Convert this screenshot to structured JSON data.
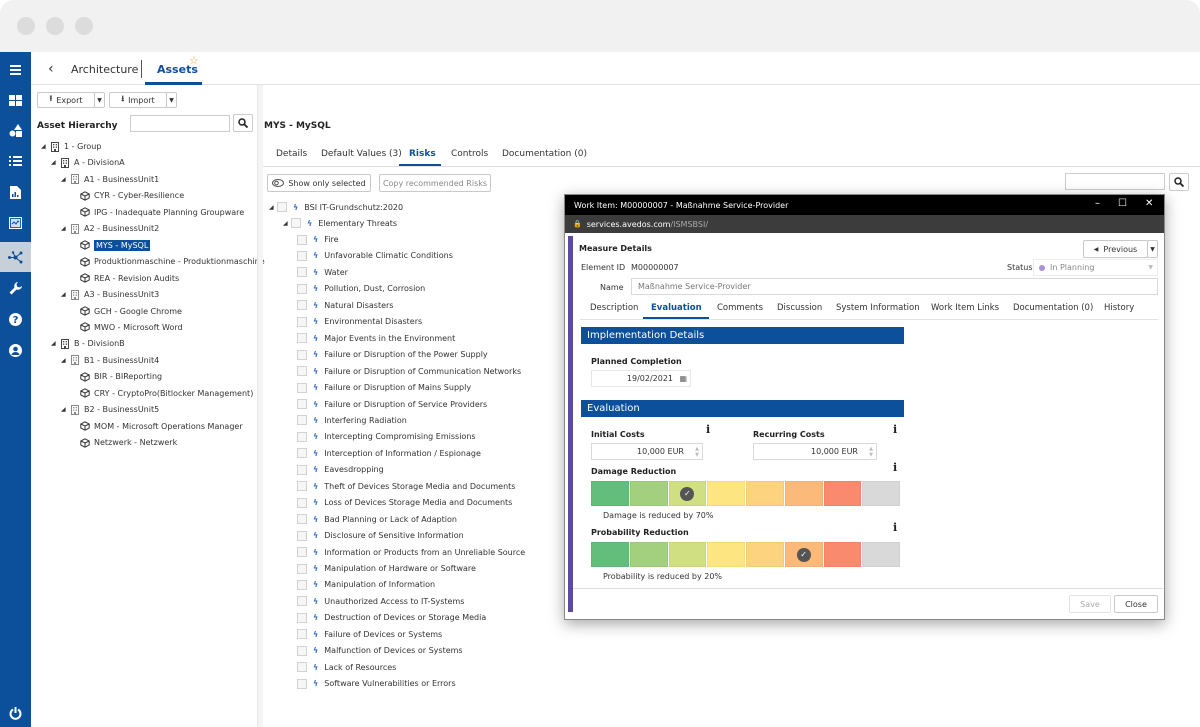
{
  "header": {
    "back_label": "Architecture",
    "active_crumb": "Assets"
  },
  "toolbar": {
    "export_label": "Export",
    "import_label": "Import"
  },
  "hierarchy": {
    "title": "Asset Hierarchy",
    "search_placeholder": "",
    "items": [
      {
        "label": "1 - Group",
        "level": 0,
        "type": "group",
        "expanded": true
      },
      {
        "label": "A - DivisionA",
        "level": 1,
        "type": "group",
        "expanded": true
      },
      {
        "label": "A1 - BusinessUnit1",
        "level": 2,
        "type": "unit",
        "expanded": true
      },
      {
        "label": "CYR - Cyber-Resilience",
        "level": 3,
        "type": "asset"
      },
      {
        "label": "IPG - Inadequate Planning Groupware",
        "level": 3,
        "type": "asset"
      },
      {
        "label": "A2 - BusinessUnit2",
        "level": 2,
        "type": "unit",
        "expanded": true
      },
      {
        "label": "MYS - MySQL",
        "level": 3,
        "type": "asset",
        "selected": true
      },
      {
        "label": "Produktionmaschine - Produktionmaschine",
        "level": 3,
        "type": "asset"
      },
      {
        "label": "REA - Revision Audits",
        "level": 3,
        "type": "asset"
      },
      {
        "label": "A3 - BusinessUnit3",
        "level": 2,
        "type": "unit",
        "expanded": true
      },
      {
        "label": "GCH - Google Chrome",
        "level": 3,
        "type": "asset"
      },
      {
        "label": "MWO - Microsoft Word",
        "level": 3,
        "type": "asset"
      },
      {
        "label": "B - DivisionB",
        "level": 1,
        "type": "group",
        "expanded": true
      },
      {
        "label": "B1 - BusinessUnit4",
        "level": 2,
        "type": "unit",
        "expanded": true
      },
      {
        "label": "BIR - BIReporting",
        "level": 3,
        "type": "asset"
      },
      {
        "label": "CRY - CryptoPro(Bitlocker Management)",
        "level": 3,
        "type": "asset"
      },
      {
        "label": "B2 - BusinessUnit5",
        "level": 2,
        "type": "unit",
        "expanded": true
      },
      {
        "label": "MOM - Microsoft Operations Manager",
        "level": 3,
        "type": "asset"
      },
      {
        "label": "Netzwerk - Netzwerk",
        "level": 3,
        "type": "asset"
      }
    ]
  },
  "asset": {
    "title": "MYS - MySQL",
    "tabs": [
      {
        "label": "Details",
        "active": false
      },
      {
        "label": "Default Values (3)",
        "active": false
      },
      {
        "label": "Risks",
        "active": true
      },
      {
        "label": "Controls",
        "active": false
      },
      {
        "label": "Documentation (0)",
        "active": false
      }
    ],
    "show_only_selected_label": "Show only selected",
    "copy_recommended_label": "Copy recommended Risks",
    "risk_root": "BSI IT-Grundschutz:2020",
    "risk_group": "Elementary Threats",
    "risks": [
      "Fire",
      "Unfavorable Climatic Conditions",
      "Water",
      "Pollution, Dust, Corrosion",
      "Natural Disasters",
      "Environmental Disasters",
      "Major Events in the Environment",
      "Failure or Disruption of the Power Supply",
      "Failure or Disruption of Communication Networks",
      "Failure or Disruption of Mains Supply",
      "Failure or Disruption of Service Providers",
      "Interfering Radiation",
      "Intercepting Compromising Emissions",
      "Interception of Information / Espionage",
      "Eavesdropping",
      "Theft of Devices Storage Media and Documents",
      "Loss of Devices Storage Media and Documents",
      "Bad Planning or Lack of Adaption",
      "Disclosure of Sensitive Information",
      "Information or Products from an Unreliable Source",
      "Manipulation of Hardware or Software",
      "Manipulation of Information",
      "Unauthorized Access to IT-Systems",
      "Destruction of Devices or Storage Media",
      "Failure of Devices or Systems",
      "Malfunction of Devices or Systems",
      "Lack of Resources",
      "Software Vulnerabilities or Errors"
    ]
  },
  "modal": {
    "window_title": "Work Item: M00000007 - Maßnahme Service-Provider",
    "url_host": "services.avedos.com",
    "url_path": "/ISMSBSI/",
    "heading": "Measure Details",
    "previous_label": "Previous",
    "element_id_label": "Element ID",
    "element_id": "M00000007",
    "status_label": "Status",
    "status_value": "In Planning",
    "status_color": "#a98fd6",
    "name_label": "Name",
    "name_value": "Maßnahme Service-Provider",
    "tabs": [
      {
        "label": "Description",
        "active": false
      },
      {
        "label": "Evaluation",
        "active": true
      },
      {
        "label": "Comments",
        "active": false
      },
      {
        "label": "Discussion",
        "active": false
      },
      {
        "label": "System Information",
        "active": false
      },
      {
        "label": "Work Item Links",
        "active": false
      },
      {
        "label": "Documentation (0)",
        "active": false
      },
      {
        "label": "History",
        "active": false
      }
    ],
    "implementation_header": "Implementation Details",
    "planned_completion_label": "Planned Completion",
    "planned_completion": "19/02/2021",
    "evaluation_header": "Evaluation",
    "initial_costs_label": "Initial Costs",
    "initial_costs": "10,000 EUR",
    "recurring_costs_label": "Recurring Costs",
    "recurring_costs": "10,000 EUR",
    "damage_label": "Damage Reduction",
    "damage_selected_index": 2,
    "damage_text": "Damage is reduced by 70%",
    "probability_label": "Probability Reduction",
    "probability_selected_index": 5,
    "probability_text": "Probability is reduced by 20%",
    "scale_colors": [
      "#63be7b",
      "#a2d07f",
      "#cfdf82",
      "#fde582",
      "#fdd37f",
      "#fcba7a",
      "#fa8a6e",
      "#d9d9d9"
    ],
    "save_label": "Save",
    "close_label": "Close"
  }
}
